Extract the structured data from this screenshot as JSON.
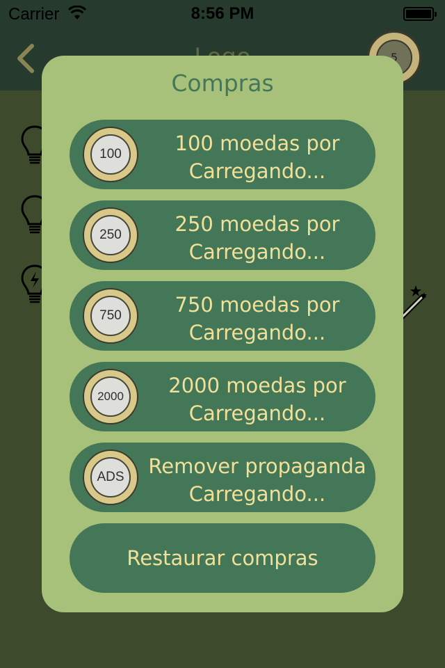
{
  "status_bar": {
    "carrier": "Carrier",
    "time": "8:56 PM"
  },
  "nav": {
    "title": "Logo",
    "coins": "5"
  },
  "modal": {
    "title": "Compras",
    "items": [
      {
        "coin_label": "100",
        "line1": "100 moedas por",
        "line2": "Carregando..."
      },
      {
        "coin_label": "250",
        "line1": "250 moedas por",
        "line2": "Carregando..."
      },
      {
        "coin_label": "750",
        "line1": "750 moedas por",
        "line2": "Carregando..."
      },
      {
        "coin_label": "2000",
        "line1": "2000 moedas por",
        "line2": "Carregando..."
      },
      {
        "coin_label": "ADS",
        "line1": "Remover propaganda",
        "line2": "Carregando..."
      }
    ],
    "restore_label": "Restaurar compras"
  },
  "colors": {
    "status_bg": "#263a2e",
    "background": "#3e4a2c",
    "modal_bg": "#a8c17a",
    "button_bg": "#447757",
    "button_text": "#f0e09a"
  },
  "icons": [
    "back-chevron",
    "coin",
    "lightbulb",
    "lightbulb-bolt",
    "magic-wand"
  ]
}
